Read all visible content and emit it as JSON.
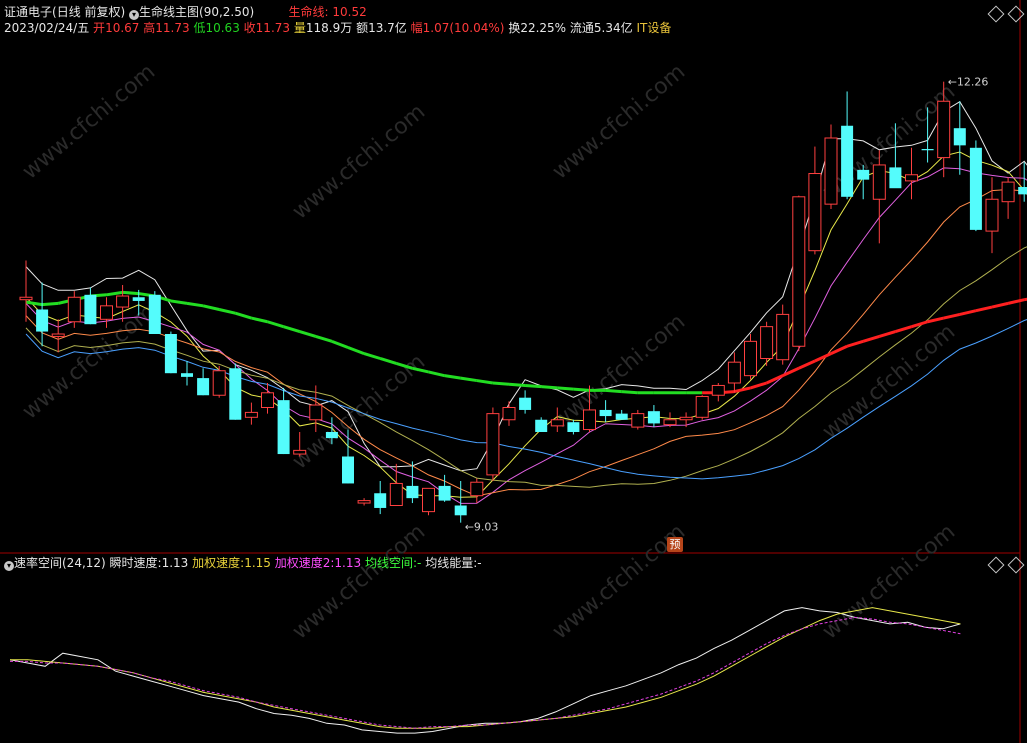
{
  "header": {
    "stock_name": "证通电子",
    "period_mode": "(日线 前复权)",
    "indicator": "生命线主图(90,2.50)",
    "lifeline_label": "生命线: 10.52",
    "date": "2023/02/24/五",
    "open_label": "开",
    "open": "10.67",
    "high_label": "高",
    "high": "11.73",
    "low_label": "低",
    "low": "10.63",
    "close_label": "收",
    "close": "11.73",
    "vol_label": "量",
    "vol": "118.9万",
    "amount": "额13.7亿",
    "change_label": "幅",
    "change": "1.07(10.04%)",
    "turnover": "换22.25%",
    "float_cap": "流通5.34亿",
    "sector": "IT设备"
  },
  "sub_header": {
    "indicator": "速率空间(24,12)",
    "instant_label": "瞬时速度:",
    "instant": "1.13",
    "accel_label": "加权速度:",
    "accel": "1.15",
    "accel2_label": "加权速度2:",
    "accel2": "1.13",
    "avg_space_label": "均线空间:",
    "avg_space": "-",
    "avg_energy_label": "均线能量:",
    "avg_energy": "-"
  },
  "badge": "预",
  "annotations": {
    "high_mark": "12.26",
    "low_mark": "9.03"
  },
  "watermark": "www.cfchi.com",
  "colors": {
    "up": "#ff4040",
    "down": "#54fcfc",
    "lifeline_down": "#22dd22",
    "lifeline_up": "#ff2020",
    "grid": "#a00000"
  },
  "chart_data": {
    "type": "candlestick",
    "price_ylim": [
      8.6,
      12.6
    ],
    "candles": [
      {
        "o": 10.48,
        "h": 10.8,
        "l": 10.3,
        "c": 10.5
      },
      {
        "o": 10.4,
        "h": 10.62,
        "l": 10.1,
        "c": 10.22
      },
      {
        "o": 10.18,
        "h": 10.32,
        "l": 10.05,
        "c": 10.2
      },
      {
        "o": 10.3,
        "h": 10.55,
        "l": 10.25,
        "c": 10.5
      },
      {
        "o": 10.52,
        "h": 10.58,
        "l": 10.28,
        "c": 10.28
      },
      {
        "o": 10.32,
        "h": 10.5,
        "l": 10.25,
        "c": 10.43
      },
      {
        "o": 10.42,
        "h": 10.6,
        "l": 10.3,
        "c": 10.51
      },
      {
        "o": 10.5,
        "h": 10.56,
        "l": 10.35,
        "c": 10.47
      },
      {
        "o": 10.52,
        "h": 10.55,
        "l": 10.2,
        "c": 10.2
      },
      {
        "o": 10.2,
        "h": 10.22,
        "l": 9.88,
        "c": 9.88
      },
      {
        "o": 9.88,
        "h": 9.98,
        "l": 9.78,
        "c": 9.85
      },
      {
        "o": 9.84,
        "h": 9.92,
        "l": 9.7,
        "c": 9.7
      },
      {
        "o": 9.7,
        "h": 9.94,
        "l": 9.68,
        "c": 9.9
      },
      {
        "o": 9.92,
        "h": 9.96,
        "l": 9.5,
        "c": 9.5
      },
      {
        "o": 9.52,
        "h": 9.64,
        "l": 9.46,
        "c": 9.56
      },
      {
        "o": 9.6,
        "h": 9.8,
        "l": 9.55,
        "c": 9.72
      },
      {
        "o": 9.66,
        "h": 9.76,
        "l": 9.22,
        "c": 9.22
      },
      {
        "o": 9.22,
        "h": 9.4,
        "l": 9.2,
        "c": 9.25
      },
      {
        "o": 9.5,
        "h": 9.78,
        "l": 9.4,
        "c": 9.62
      },
      {
        "o": 9.4,
        "h": 9.52,
        "l": 9.3,
        "c": 9.35
      },
      {
        "o": 9.2,
        "h": 9.42,
        "l": 8.98,
        "c": 8.98
      },
      {
        "o": 8.82,
        "h": 8.86,
        "l": 8.8,
        "c": 8.84
      },
      {
        "o": 8.9,
        "h": 9.0,
        "l": 8.73,
        "c": 8.78
      },
      {
        "o": 8.8,
        "h": 9.14,
        "l": 8.8,
        "c": 8.98
      },
      {
        "o": 8.96,
        "h": 9.16,
        "l": 8.82,
        "c": 8.86
      },
      {
        "o": 8.75,
        "h": 8.94,
        "l": 8.72,
        "c": 8.94
      },
      {
        "o": 8.96,
        "h": 9.05,
        "l": 8.83,
        "c": 8.84
      },
      {
        "o": 8.8,
        "h": 9.0,
        "l": 8.66,
        "c": 8.72
      },
      {
        "o": 8.88,
        "h": 9.02,
        "l": 8.82,
        "c": 8.99
      },
      {
        "o": 9.05,
        "h": 9.6,
        "l": 9.0,
        "c": 9.55
      },
      {
        "o": 9.5,
        "h": 9.65,
        "l": 9.45,
        "c": 9.6
      },
      {
        "o": 9.68,
        "h": 9.74,
        "l": 9.55,
        "c": 9.58
      },
      {
        "o": 9.5,
        "h": 9.52,
        "l": 9.4,
        "c": 9.4
      },
      {
        "o": 9.45,
        "h": 9.6,
        "l": 9.4,
        "c": 9.5
      },
      {
        "o": 9.48,
        "h": 9.5,
        "l": 9.38,
        "c": 9.4
      },
      {
        "o": 9.42,
        "h": 9.78,
        "l": 9.4,
        "c": 9.58
      },
      {
        "o": 9.58,
        "h": 9.66,
        "l": 9.48,
        "c": 9.53
      },
      {
        "o": 9.55,
        "h": 9.58,
        "l": 9.5,
        "c": 9.5
      },
      {
        "o": 9.44,
        "h": 9.58,
        "l": 9.42,
        "c": 9.55
      },
      {
        "o": 9.57,
        "h": 9.62,
        "l": 9.44,
        "c": 9.47
      },
      {
        "o": 9.46,
        "h": 9.56,
        "l": 9.44,
        "c": 9.5
      },
      {
        "o": 9.5,
        "h": 9.56,
        "l": 9.44,
        "c": 9.52
      },
      {
        "o": 9.52,
        "h": 9.7,
        "l": 9.5,
        "c": 9.69
      },
      {
        "o": 9.7,
        "h": 9.8,
        "l": 9.65,
        "c": 9.78
      },
      {
        "o": 9.8,
        "h": 10.05,
        "l": 9.72,
        "c": 9.97
      },
      {
        "o": 9.86,
        "h": 10.2,
        "l": 9.83,
        "c": 10.14
      },
      {
        "o": 10.0,
        "h": 10.3,
        "l": 9.94,
        "c": 10.26
      },
      {
        "o": 9.99,
        "h": 10.44,
        "l": 9.95,
        "c": 10.36
      },
      {
        "o": 10.1,
        "h": 11.33,
        "l": 10.06,
        "c": 11.32
      },
      {
        "o": 10.88,
        "h": 11.73,
        "l": 10.85,
        "c": 11.51
      },
      {
        "o": 11.26,
        "h": 11.91,
        "l": 11.22,
        "c": 11.8
      },
      {
        "o": 11.9,
        "h": 12.18,
        "l": 11.3,
        "c": 11.32
      },
      {
        "o": 11.54,
        "h": 11.58,
        "l": 11.3,
        "c": 11.46
      },
      {
        "o": 11.3,
        "h": 11.7,
        "l": 10.94,
        "c": 11.58
      },
      {
        "o": 11.56,
        "h": 11.92,
        "l": 11.4,
        "c": 11.39
      },
      {
        "o": 11.45,
        "h": 11.72,
        "l": 11.3,
        "c": 11.5
      },
      {
        "o": 11.71,
        "h": 12.05,
        "l": 11.6,
        "c": 11.7
      },
      {
        "o": 11.64,
        "h": 12.26,
        "l": 11.48,
        "c": 12.1
      },
      {
        "o": 11.88,
        "h": 12.1,
        "l": 11.5,
        "c": 11.74
      },
      {
        "o": 11.72,
        "h": 11.78,
        "l": 11.04,
        "c": 11.05
      },
      {
        "o": 11.04,
        "h": 11.48,
        "l": 10.86,
        "c": 11.3
      },
      {
        "o": 11.28,
        "h": 11.48,
        "l": 11.14,
        "c": 11.44
      },
      {
        "o": 11.4,
        "h": 11.6,
        "l": 11.28,
        "c": 11.34
      },
      {
        "o": 11.46,
        "h": 11.52,
        "l": 10.74,
        "c": 10.8
      },
      {
        "o": 10.67,
        "h": 11.73,
        "l": 10.63,
        "c": 11.73
      }
    ],
    "lifeline": [
      10.46,
      10.44,
      10.45,
      10.48,
      10.51,
      10.52,
      10.54,
      10.53,
      10.51,
      10.47,
      10.45,
      10.43,
      10.4,
      10.37,
      10.33,
      10.3,
      10.26,
      10.22,
      10.18,
      10.14,
      10.09,
      10.04,
      10.0,
      9.96,
      9.92,
      9.89,
      9.86,
      9.84,
      9.82,
      9.8,
      9.79,
      9.78,
      9.77,
      9.76,
      9.75,
      9.74,
      9.74,
      9.73,
      9.72,
      9.72,
      9.72,
      9.72,
      9.72,
      9.72,
      9.73,
      9.76,
      9.8,
      9.86,
      9.92,
      9.98,
      10.04,
      10.1,
      10.14,
      10.18,
      10.22,
      10.26,
      10.3,
      10.33,
      10.36,
      10.39,
      10.42,
      10.45,
      10.48,
      10.5,
      10.52
    ],
    "sub_ylim": [
      0,
      100
    ],
    "speed_white": [
      48,
      46,
      44,
      52,
      50,
      48,
      41,
      38,
      35,
      32,
      29,
      26,
      24,
      22,
      18,
      15,
      14,
      12,
      9,
      8,
      5,
      4,
      3,
      3,
      4,
      6,
      8,
      9,
      9,
      10,
      12,
      16,
      21,
      26,
      29,
      32,
      36,
      40,
      45,
      49,
      55,
      60,
      66,
      72,
      78,
      80,
      78,
      77,
      74,
      72,
      70,
      71,
      68,
      67,
      70
    ],
    "speed_yellow": [
      48,
      48,
      47,
      46,
      45,
      44,
      42,
      40,
      37,
      34,
      31,
      28,
      26,
      24,
      22,
      19,
      17,
      15,
      13,
      11,
      9,
      7,
      6,
      6,
      6,
      7,
      7,
      8,
      9,
      10,
      11,
      12,
      13,
      15,
      17,
      19,
      22,
      25,
      29,
      33,
      38,
      44,
      50,
      56,
      62,
      67,
      72,
      76,
      78,
      80,
      78,
      76,
      74,
      72,
      70
    ],
    "speed_magenta": [
      47,
      47,
      46,
      46,
      45,
      44,
      42,
      40,
      37,
      35,
      32,
      29,
      27,
      25,
      22,
      20,
      18,
      16,
      14,
      12,
      10,
      8,
      7,
      6,
      7,
      7,
      8,
      8,
      9,
      10,
      11,
      12,
      14,
      16,
      18,
      21,
      24,
      27,
      31,
      35,
      40,
      46,
      52,
      58,
      63,
      67,
      70,
      72,
      74,
      73,
      71,
      70,
      68,
      66,
      64
    ]
  }
}
